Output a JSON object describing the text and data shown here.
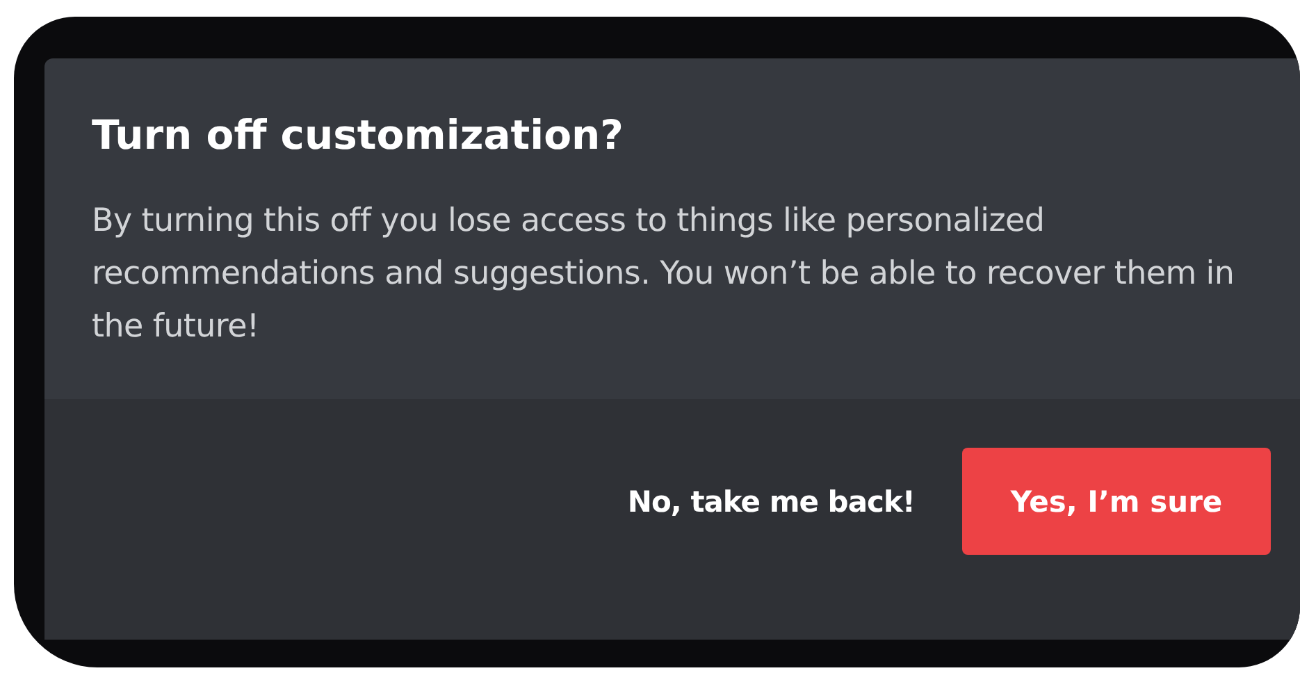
{
  "dialog": {
    "title": "Turn off customization?",
    "message": "By turning this off you lose access to things like personalized recommendations and suggestions. You won’t be able to recover them in the future!",
    "buttons": [
      {
        "label": "No, take me back!",
        "kind": "link"
      },
      {
        "label": "Yes, I’m sure",
        "kind": "danger"
      }
    ]
  }
}
